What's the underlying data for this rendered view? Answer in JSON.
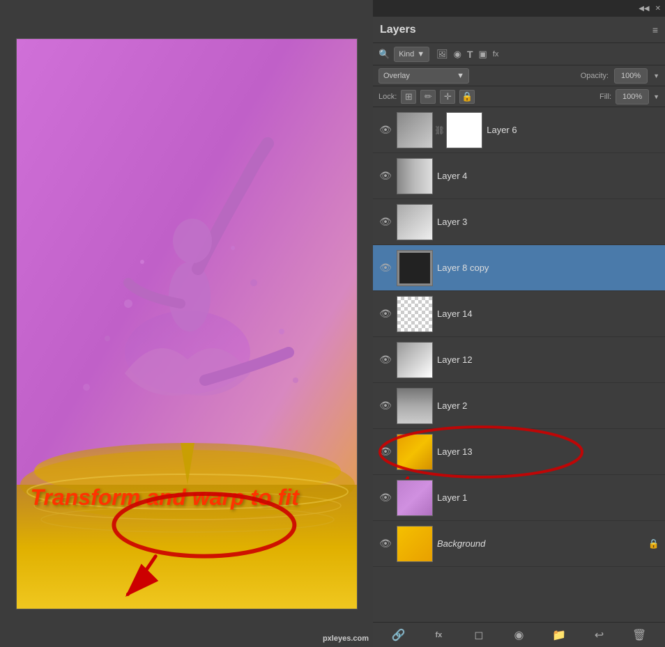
{
  "panel": {
    "title": "Layers",
    "menu_icon": "≡",
    "topbar": {
      "collapse_label": "◀◀",
      "close_label": "✕"
    },
    "kind_row": {
      "search_icon": "🔍",
      "kind_label": "Kind",
      "dropdown_arrow": "▼",
      "icon_image": "🖼",
      "icon_circle": "◉",
      "icon_text": "T",
      "icon_rect": "▣",
      "icon_fx": "fx"
    },
    "blend_row": {
      "blend_mode": "Overlay",
      "blend_arrow": "▼",
      "opacity_label": "Opacity:",
      "opacity_value": "100%",
      "opacity_arrow": "▼"
    },
    "lock_row": {
      "lock_label": "Lock:",
      "icon_grid": "⊞",
      "icon_brush": "✏",
      "icon_move": "✛",
      "icon_lock": "🔒",
      "fill_label": "Fill:",
      "fill_value": "100%",
      "fill_arrow": "▼"
    },
    "layers": [
      {
        "id": "layer6",
        "name": "Layer 6",
        "visible": true,
        "active": false,
        "has_mask": true,
        "has_chain": true,
        "locked": false,
        "thumb_type": "layer6"
      },
      {
        "id": "layer4",
        "name": "Layer 4",
        "visible": true,
        "active": false,
        "has_mask": false,
        "locked": false,
        "thumb_type": "layer4"
      },
      {
        "id": "layer3",
        "name": "Layer 3",
        "visible": true,
        "active": false,
        "has_mask": false,
        "locked": false,
        "thumb_type": "layer3"
      },
      {
        "id": "layer8copy",
        "name": "Layer 8 copy",
        "visible": true,
        "active": true,
        "has_mask": false,
        "locked": false,
        "thumb_type": "layer8copy"
      },
      {
        "id": "layer14",
        "name": "Layer 14",
        "visible": true,
        "active": false,
        "has_mask": false,
        "locked": false,
        "thumb_type": "layer14"
      },
      {
        "id": "layer12",
        "name": "Layer 12",
        "visible": true,
        "active": false,
        "has_mask": false,
        "locked": false,
        "thumb_type": "layer12"
      },
      {
        "id": "layer2",
        "name": "Layer 2",
        "visible": true,
        "active": false,
        "has_mask": false,
        "locked": false,
        "thumb_type": "layer2"
      },
      {
        "id": "layer13",
        "name": "Layer 13",
        "visible": true,
        "active": false,
        "has_mask": false,
        "locked": false,
        "thumb_type": "layer13",
        "has_annotation": true
      },
      {
        "id": "layer1",
        "name": "Layer 1",
        "visible": true,
        "active": false,
        "has_mask": false,
        "locked": false,
        "thumb_type": "layer1"
      },
      {
        "id": "background",
        "name": "Background",
        "visible": true,
        "active": false,
        "has_mask": false,
        "locked": true,
        "thumb_type": "background"
      }
    ],
    "bottom_tools": {
      "link_icon": "🔗",
      "fx_label": "fx",
      "new_layer_icon": "◻",
      "mask_icon": "◉",
      "folder_icon": "📁",
      "arrow_icon": "↩",
      "delete_icon": "🗑"
    }
  },
  "canvas": {
    "annotation_text": "Transform and warp to fit",
    "watermark": "pxleyes.com"
  }
}
